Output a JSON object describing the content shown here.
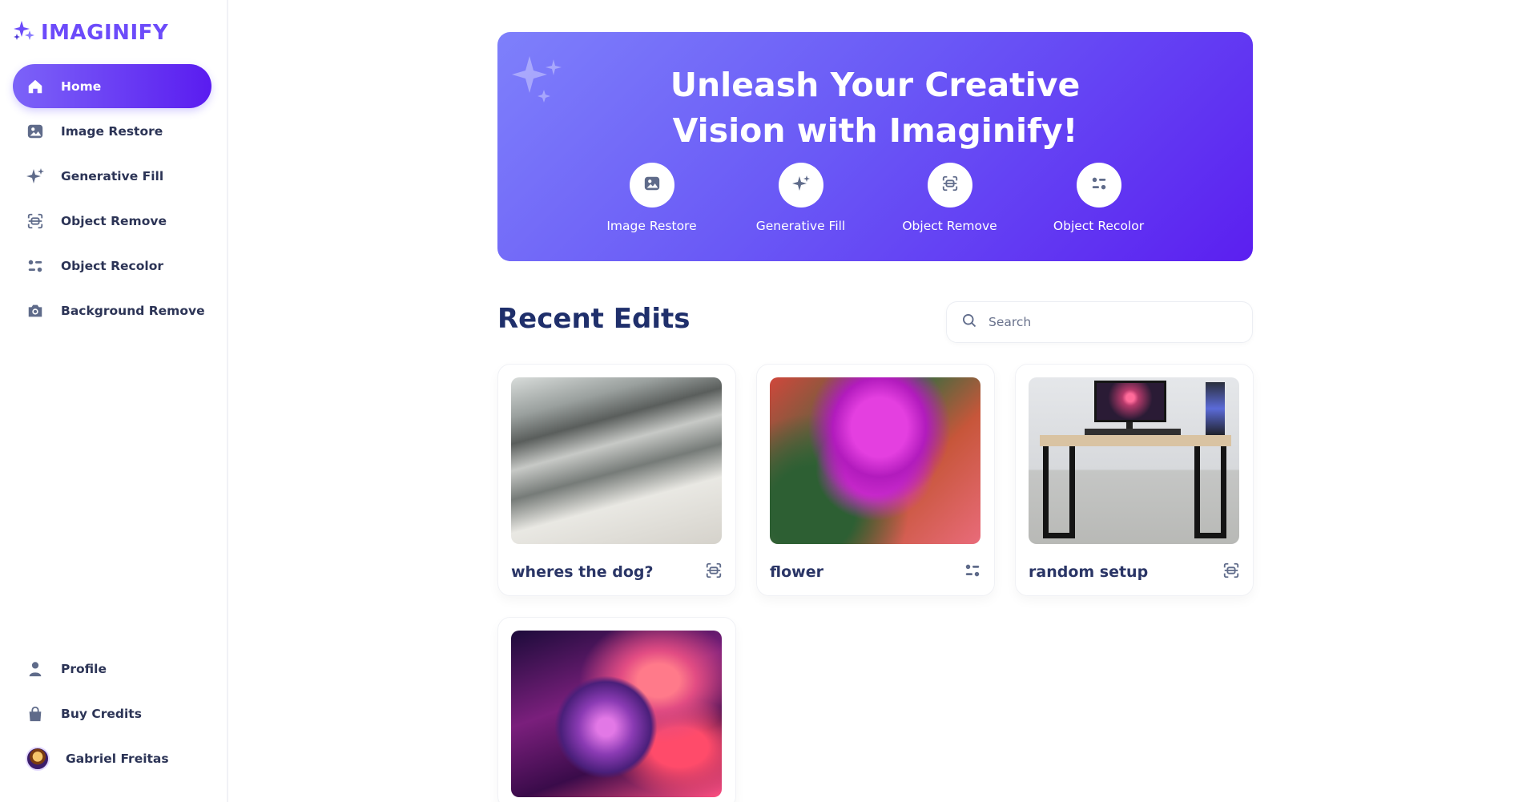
{
  "brand": {
    "name": "IMAGINIFY",
    "color": "#6c4bfa"
  },
  "sidebar": {
    "items": [
      {
        "label": "Home",
        "icon": "home-icon",
        "active": true
      },
      {
        "label": "Image Restore",
        "icon": "image-icon",
        "active": false
      },
      {
        "label": "Generative Fill",
        "icon": "sparkles-icon",
        "active": false
      },
      {
        "label": "Object Remove",
        "icon": "scan-icon",
        "active": false
      },
      {
        "label": "Object Recolor",
        "icon": "filter-icon",
        "active": false
      },
      {
        "label": "Background Remove",
        "icon": "camera-icon",
        "active": false
      }
    ],
    "bottom_items": [
      {
        "label": "Profile",
        "icon": "user-icon"
      },
      {
        "label": "Buy Credits",
        "icon": "bag-icon"
      }
    ],
    "user": {
      "name": "Gabriel Freitas"
    }
  },
  "banner": {
    "title_line1": "Unleash Your Creative",
    "title_line2": "Vision with Imaginify!",
    "tools": [
      {
        "label": "Image Restore",
        "icon": "image-icon"
      },
      {
        "label": "Generative Fill",
        "icon": "sparkles-icon"
      },
      {
        "label": "Object Remove",
        "icon": "scan-icon"
      },
      {
        "label": "Object Recolor",
        "icon": "filter-icon"
      }
    ]
  },
  "recent": {
    "title": "Recent Edits",
    "search": {
      "placeholder": "Search",
      "value": ""
    },
    "cards": [
      {
        "title": "wheres the dog?",
        "type_icon": "scan-icon"
      },
      {
        "title": "flower",
        "type_icon": "filter-icon"
      },
      {
        "title": "random setup",
        "type_icon": "scan-icon"
      },
      {
        "title": "",
        "type_icon": ""
      }
    ]
  },
  "colors": {
    "accent_start": "#7c63f8",
    "accent_end": "#5a1cf0",
    "heading": "#1f2f6b",
    "icon_gray": "#5f6b8a"
  }
}
